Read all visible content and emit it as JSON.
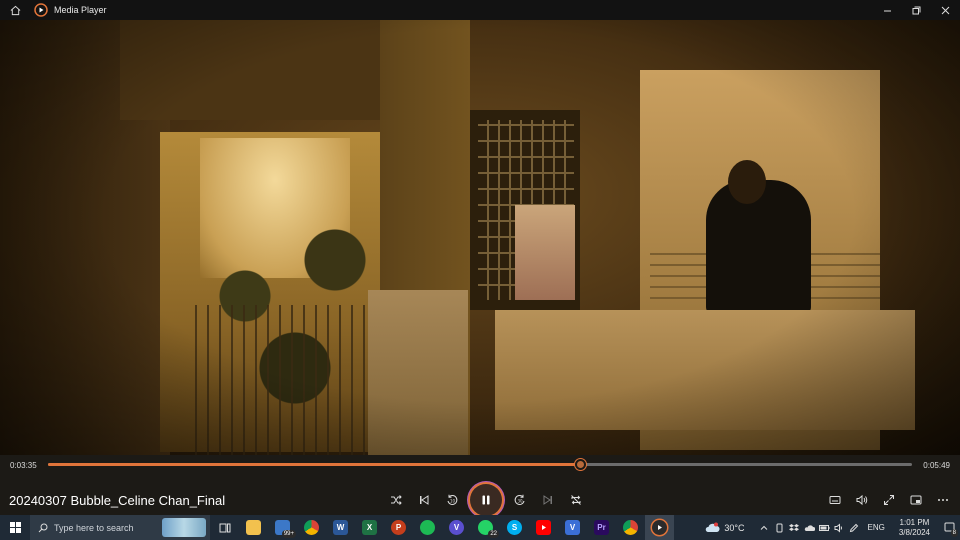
{
  "window": {
    "title": "Media Player"
  },
  "player": {
    "current_time": "0:03:35",
    "duration": "0:05:49",
    "progress": 0.616,
    "media_title": "20240307 Bubble_Celine Chan_Final"
  },
  "taskbar": {
    "search_placeholder": "Type here to search",
    "apps": [
      {
        "name": "task-view"
      },
      {
        "name": "file-explorer"
      },
      {
        "name": "mail",
        "badge": "99+"
      },
      {
        "name": "chrome"
      },
      {
        "name": "word",
        "letter": "W",
        "color": "#2b5797"
      },
      {
        "name": "excel",
        "letter": "X",
        "color": "#1f7244"
      },
      {
        "name": "powerpoint",
        "letter": "P",
        "color": "#c43e1c"
      },
      {
        "name": "spotify",
        "color": "#1db954"
      },
      {
        "name": "vpn",
        "letter": "V",
        "color": "#5a4fcf"
      },
      {
        "name": "whatsapp",
        "badge": "22",
        "color": "#25d366"
      },
      {
        "name": "skype",
        "letter": "S",
        "color": "#00aff0"
      },
      {
        "name": "youtube",
        "color": "#ff0000"
      },
      {
        "name": "vegas",
        "letter": "V",
        "color": "#3b6fd6"
      },
      {
        "name": "premiere",
        "letter": "Pr",
        "color": "#2a0a5e"
      },
      {
        "name": "chrome-2"
      },
      {
        "name": "media-player"
      }
    ],
    "weather": "30°C",
    "language": "ENG",
    "time": "1:01 PM",
    "date": "3/8/2024",
    "notifications": "8"
  },
  "colors": {
    "accent": "#e0743a",
    "taskbar": "#1f2a36",
    "controls": "#1c1a16"
  }
}
